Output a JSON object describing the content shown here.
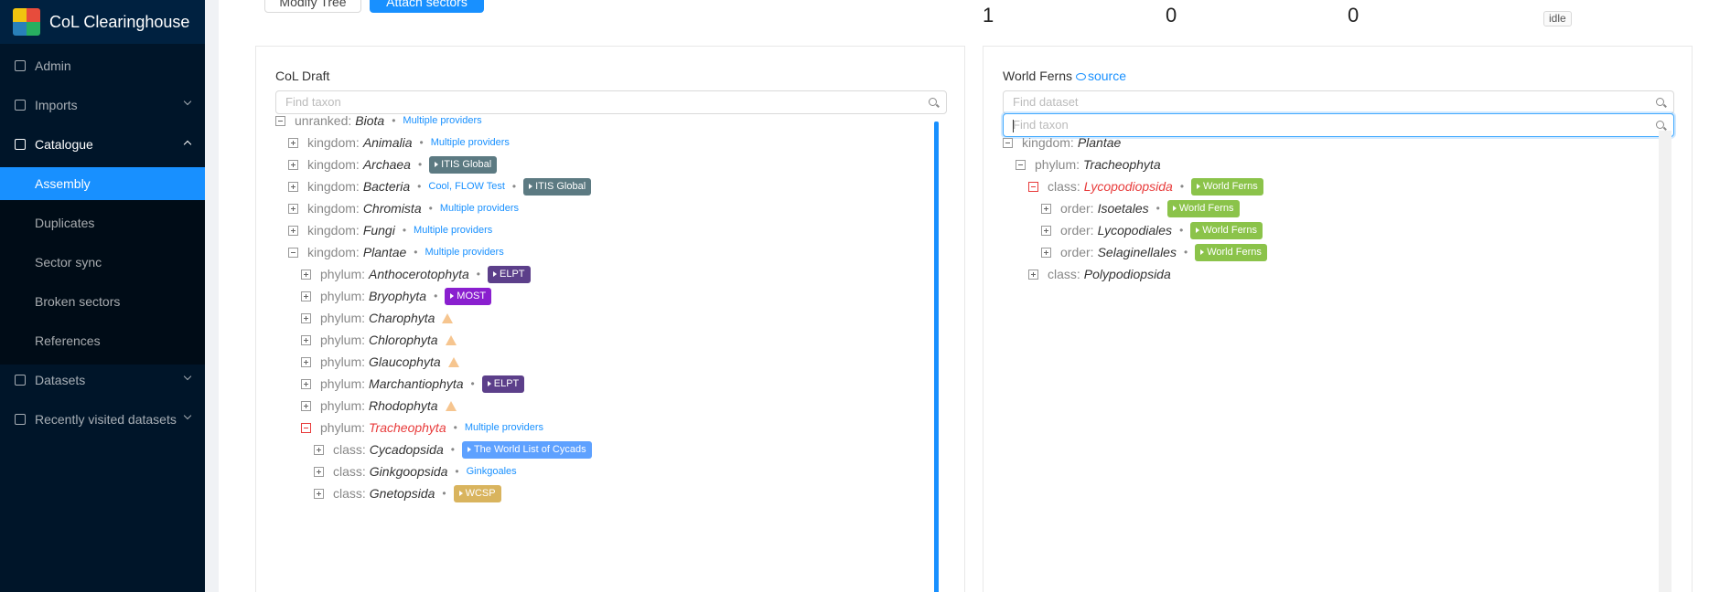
{
  "app": {
    "title": "CoL Clearinghouse"
  },
  "sidebar": {
    "items": [
      {
        "label": "Admin",
        "icon": "gear-icon"
      },
      {
        "label": "Imports",
        "icon": "link-icon"
      },
      {
        "label": "Catalogue",
        "icon": "book-icon"
      },
      {
        "label": "Datasets",
        "icon": "table-icon"
      },
      {
        "label": "Recently visited datasets",
        "icon": "star-icon"
      }
    ],
    "catalogue_sub": [
      "Assembly",
      "Duplicates",
      "Sector sync",
      "Broken sectors",
      "References"
    ]
  },
  "toolbar": {
    "modify_label": "Modify Tree",
    "attach_label": "Attach sectors"
  },
  "stats": [
    "1",
    "0",
    "0"
  ],
  "status": "idle",
  "left": {
    "title": "CoL Draft",
    "search_placeholder": "Find taxon",
    "rows": [
      {
        "rank": "unranked:",
        "name": "Biota",
        "prov": "Multiple providers"
      },
      {
        "rank": "kingdom:",
        "name": "Animalia",
        "prov": "Multiple providers"
      },
      {
        "rank": "kingdom:",
        "name": "Archaea",
        "tag": "ITIS Global"
      },
      {
        "rank": "kingdom:",
        "name": "Bacteria",
        "prov": "Cool, FLOW Test",
        "tag": "ITIS Global"
      },
      {
        "rank": "kingdom:",
        "name": "Chromista",
        "prov": "Multiple providers"
      },
      {
        "rank": "kingdom:",
        "name": "Fungi",
        "prov": "Multiple providers"
      },
      {
        "rank": "kingdom:",
        "name": "Plantae",
        "prov": "Multiple providers"
      },
      {
        "rank": "phylum:",
        "name": "Anthocerotophyta",
        "tag": "ELPT"
      },
      {
        "rank": "phylum:",
        "name": "Bryophyta",
        "tag": "MOST"
      },
      {
        "rank": "phylum:",
        "name": "Charophyta"
      },
      {
        "rank": "phylum:",
        "name": "Chlorophyta"
      },
      {
        "rank": "phylum:",
        "name": "Glaucophyta"
      },
      {
        "rank": "phylum:",
        "name": "Marchantiophyta",
        "tag": "ELPT"
      },
      {
        "rank": "phylum:",
        "name": "Rhodophyta"
      },
      {
        "rank": "phylum:",
        "name": "Tracheophyta",
        "prov": "Multiple providers"
      },
      {
        "rank": "class:",
        "name": "Cycadopsida",
        "tag": "The World List of Cycads"
      },
      {
        "rank": "class:",
        "name": "Ginkgoopsida",
        "prov": "Ginkgoales"
      },
      {
        "rank": "class:",
        "name": "Gnetopsida",
        "tag": "WCSP"
      }
    ]
  },
  "right": {
    "title": "World Ferns",
    "source_label": "source",
    "dataset_placeholder": "Find dataset",
    "search_placeholder": "Find taxon",
    "rows": [
      {
        "rank": "kingdom:",
        "name": "Plantae"
      },
      {
        "rank": "phylum:",
        "name": "Tracheophyta"
      },
      {
        "rank": "class:",
        "name": "Lycopodiopsida",
        "tag": "World Ferns"
      },
      {
        "rank": "order:",
        "name": "Isoetales",
        "tag": "World Ferns"
      },
      {
        "rank": "order:",
        "name": "Lycopodiales",
        "tag": "World Ferns"
      },
      {
        "rank": "order:",
        "name": "Selaginellales",
        "tag": "World Ferns"
      },
      {
        "rank": "class:",
        "name": "Polypodiopsida"
      }
    ]
  },
  "colors": {
    "primary": "#1890ff",
    "sidebar": "#001529",
    "elpt": "#5c3f8a",
    "most": "#8a1fcf",
    "itis": "#5c7a82",
    "cycads": "#5ea1ff",
    "wcsp": "#d9b45e",
    "worldferns": "#8bc34a",
    "error": "#e83b3b"
  }
}
